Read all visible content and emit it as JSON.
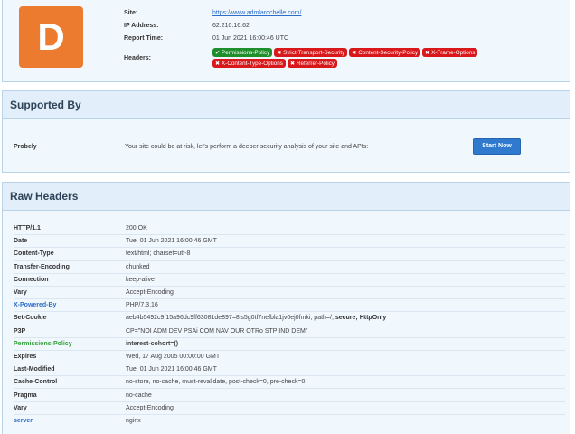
{
  "summary": {
    "grade": "D",
    "site_label": "Site:",
    "site_value": "https://www.admlarochelle.com/",
    "ip_label": "IP Address:",
    "ip_value": "62.210.16.62",
    "time_label": "Report Time:",
    "time_value": "01 Jun 2021 16:00:46 UTC",
    "headers_label": "Headers:",
    "badges": [
      {
        "label": "Permissions-Policy",
        "status": "ok",
        "icon": "check-icon"
      },
      {
        "label": "Strict-Transport-Security",
        "status": "bad",
        "icon": "x-icon"
      },
      {
        "label": "Content-Security-Policy",
        "status": "bad",
        "icon": "x-icon"
      },
      {
        "label": "X-Frame-Options",
        "status": "bad",
        "icon": "x-icon"
      },
      {
        "label": "X-Content-Type-Options",
        "status": "bad",
        "icon": "x-icon"
      },
      {
        "label": "Referrer-Policy",
        "status": "bad",
        "icon": "x-icon"
      }
    ],
    "colors": {
      "grade": "#ec7b30",
      "ok": "#1f8f2d",
      "bad": "#d9181b"
    }
  },
  "supported": {
    "title": "Supported By",
    "sponsor": "Probely",
    "text": "Your site could be at risk, let's perform a deeper security analysis of your site and APIs:",
    "button": "Start Now"
  },
  "raw": {
    "title": "Raw Headers",
    "rows": [
      {
        "key": "HTTP/1.1",
        "value": "200 OK",
        "color": "default"
      },
      {
        "key": "Date",
        "value": "Tue, 01 Jun 2021 16:00:46 GMT",
        "color": "default"
      },
      {
        "key": "Content-Type",
        "value": "text/html; charset=utf-8",
        "color": "default"
      },
      {
        "key": "Transfer-Encoding",
        "value": "chunked",
        "color": "default"
      },
      {
        "key": "Connection",
        "value": "keep-alive",
        "color": "default"
      },
      {
        "key": "Vary",
        "value": "Accept-Encoding",
        "color": "default"
      },
      {
        "key": "X-Powered-By",
        "value": "PHP/7.3.16",
        "color": "blue"
      },
      {
        "key": "Set-Cookie",
        "value": "aeb4b5492c9f15a96dc9ff63081de897=8is5g0tf7nefbla1jv0ej0fmki; path=/;",
        "value_bold": " secure; HttpOnly",
        "color": "default"
      },
      {
        "key": "P3P",
        "value": "CP=\"NOI ADM DEV PSAi COM NAV OUR OTRo STP IND DEM\"",
        "color": "default"
      },
      {
        "key": "Permissions-Policy",
        "value": "interest-cohort=()",
        "color": "green",
        "bold_value": true
      },
      {
        "key": "Expires",
        "value": "Wed, 17 Aug 2005 00:00:00 GMT",
        "color": "default"
      },
      {
        "key": "Last-Modified",
        "value": "Tue, 01 Jun 2021 16:00:46 GMT",
        "color": "default"
      },
      {
        "key": "Cache-Control",
        "value": "no-store, no-cache, must-revalidate, post-check=0, pre-check=0",
        "color": "default"
      },
      {
        "key": "Pragma",
        "value": "no-cache",
        "color": "default"
      },
      {
        "key": "Vary",
        "value": "Accept-Encoding",
        "color": "default"
      },
      {
        "key": "server",
        "value": "nginx",
        "color": "blue"
      }
    ]
  }
}
